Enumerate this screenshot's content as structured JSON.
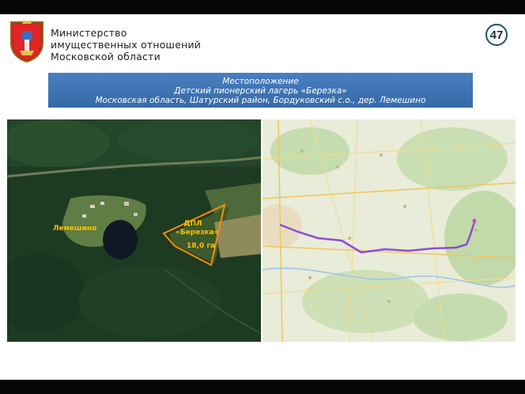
{
  "header": {
    "ministry_line1": "Министерство",
    "ministry_line2": "имущественных отношений",
    "ministry_line3": "Московской области",
    "page_number": "47",
    "emblem_icon": "moscow-oblast-coat-of-arms-icon"
  },
  "banner": {
    "line1": "Местоположение",
    "line2": "Детский пионерский лагерь «Березка»",
    "line3": "Московская область, Шатурский район, Бордуковский с.о., дер. Лемешино"
  },
  "satellite": {
    "village_label": "Лемешино",
    "camp_label_line1": "ДПЛ",
    "camp_label_line2": "«Березка»",
    "area_label": "18,0 га",
    "outline_color": "#ff8c00",
    "label_color": "#ffc000"
  },
  "route_map": {
    "route_color": "#8a4fd6"
  },
  "colors": {
    "banner": "#3f73b4",
    "badge_border": "#1e4e79"
  }
}
